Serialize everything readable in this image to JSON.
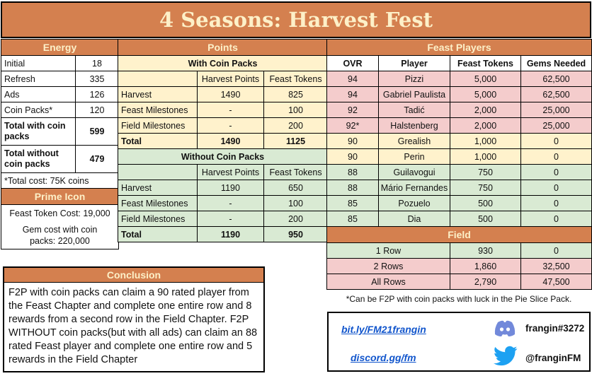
{
  "title": "4 Seasons: Harvest Fest",
  "energy": {
    "header": "Energy",
    "rows": [
      {
        "label": "Initial",
        "value": "18"
      },
      {
        "label": "Refresh",
        "value": "335"
      },
      {
        "label": "Ads",
        "value": "126"
      },
      {
        "label": "Coin Packs*",
        "value": "120"
      }
    ],
    "total_with": {
      "label": "Total with coin packs",
      "value": "599"
    },
    "total_without": {
      "label": "Total without coin packs",
      "value": "479"
    },
    "footnote": "*Total cost: 75K coins"
  },
  "prime_icon": {
    "header": "Prime Icon",
    "feast_token_cost": "Feast Token Cost: 19,000",
    "gem_cost": "Gem cost with coin packs: 220,000"
  },
  "points": {
    "header": "Points",
    "columns": [
      "",
      "Harvest Points",
      "Feast Tokens"
    ],
    "with_coin_packs": {
      "title": "With Coin Packs",
      "rows": [
        {
          "label": "Harvest",
          "harvest_points": "1490",
          "feast_tokens": "825"
        },
        {
          "label": "Feast Milestones",
          "harvest_points": "-",
          "feast_tokens": "100"
        },
        {
          "label": "Field Milestones",
          "harvest_points": "-",
          "feast_tokens": "200"
        }
      ],
      "total": {
        "label": "Total",
        "harvest_points": "1490",
        "feast_tokens": "1125"
      }
    },
    "without_coin_packs": {
      "title": "Without Coin Packs",
      "rows": [
        {
          "label": "Harvest",
          "harvest_points": "1190",
          "feast_tokens": "650"
        },
        {
          "label": "Feast Milestones",
          "harvest_points": "-",
          "feast_tokens": "100"
        },
        {
          "label": "Field Milestones",
          "harvest_points": "-",
          "feast_tokens": "200"
        }
      ],
      "total": {
        "label": "Total",
        "harvest_points": "1190",
        "feast_tokens": "950"
      }
    }
  },
  "feast_players": {
    "header": "Feast Players",
    "columns": [
      "OVR",
      "Player",
      "Feast Tokens",
      "Gems Needed"
    ],
    "rows": [
      {
        "ovr": "94",
        "player": "Pizzi",
        "tokens": "5,000",
        "gems": "62,500",
        "tier": "pink"
      },
      {
        "ovr": "94",
        "player": "Gabriel Paulista",
        "tokens": "5,000",
        "gems": "62,500",
        "tier": "pink"
      },
      {
        "ovr": "92",
        "player": "Tadić",
        "tokens": "2,000",
        "gems": "25,000",
        "tier": "pink"
      },
      {
        "ovr": "92*",
        "player": "Halstenberg",
        "tokens": "2,000",
        "gems": "25,000",
        "tier": "pink"
      },
      {
        "ovr": "90",
        "player": "Grealish",
        "tokens": "1,000",
        "gems": "0",
        "tier": "cream"
      },
      {
        "ovr": "90",
        "player": "Perin",
        "tokens": "1,000",
        "gems": "0",
        "tier": "cream"
      },
      {
        "ovr": "88",
        "player": "Guilavogui",
        "tokens": "750",
        "gems": "0",
        "tier": "green"
      },
      {
        "ovr": "88",
        "player": "Mário Fernandes",
        "tokens": "750",
        "gems": "0",
        "tier": "green"
      },
      {
        "ovr": "85",
        "player": "Pozuelo",
        "tokens": "500",
        "gems": "0",
        "tier": "green"
      },
      {
        "ovr": "85",
        "player": "Dia",
        "tokens": "500",
        "gems": "0",
        "tier": "green"
      }
    ]
  },
  "field": {
    "header": "Field",
    "rows": [
      {
        "label": "1 Row",
        "tokens": "930",
        "gems": "0",
        "tier": "green"
      },
      {
        "label": "2 Rows",
        "tokens": "1,860",
        "gems": "32,500",
        "tier": "pink"
      },
      {
        "label": "All Rows",
        "tokens": "2,790",
        "gems": "47,500",
        "tier": "pink"
      }
    ],
    "footnote": "*Can be F2P with coin packs with luck in the Pie Slice Pack."
  },
  "conclusion": {
    "header": "Conclusion",
    "text": "F2P with coin packs can claim a 90 rated player from the Feast Chapter and complete one entire row and 8 rewards from a second row in the Field Chapter. F2P WITHOUT coin packs(but with all ads) can claim an 88 rated Feast player and complete one entire row and 5 rewards in the Field Chapter"
  },
  "links": {
    "bitly": "bit.ly/FM21frangin",
    "discord_link": "discord.gg/fm",
    "discord_handle": "frangin#3272",
    "twitter_handle": "@franginFM",
    "discord_color": "#7289da",
    "twitter_color": "#1da1f2"
  }
}
